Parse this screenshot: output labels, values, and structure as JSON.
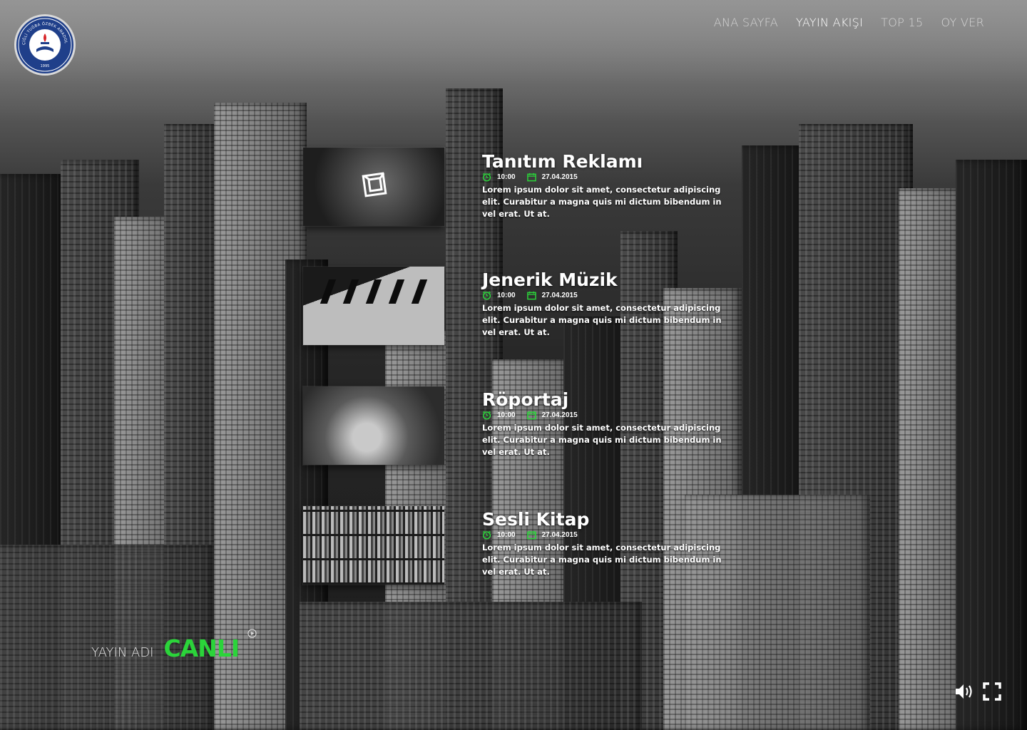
{
  "logo": {
    "text": "ÇİĞLİ TUĞBA ÖZBEK ANADOLU LİSESİ",
    "year": "1995"
  },
  "nav": [
    {
      "label": "ANA SAYFA",
      "active": false
    },
    {
      "label": "YAYIN AKIŞI",
      "active": true
    },
    {
      "label": "TOP 15",
      "active": false
    },
    {
      "label": "OY VER",
      "active": false
    }
  ],
  "schedule": [
    {
      "title": "Tanıtım Reklamı",
      "time": "10:00",
      "date": "27.04.2015",
      "description": "Lorem ipsum dolor sit amet, consectetur adipiscing elit. Curabitur a magna quis mi dictum bibendum in vel erat. Ut at."
    },
    {
      "title": "Jenerik Müzik",
      "time": "10:00",
      "date": "27.04.2015",
      "description": "Lorem ipsum dolor sit amet, consectetur adipiscing elit. Curabitur a magna quis mi dictum bibendum in vel erat. Ut at."
    },
    {
      "title": "Röportaj",
      "time": "10:00",
      "date": "27.04.2015",
      "description": "Lorem ipsum dolor sit amet, consectetur adipiscing elit. Curabitur a magna quis mi dictum bibendum in vel erat. Ut at."
    },
    {
      "title": "Sesli Kitap",
      "time": "10:00",
      "date": "27.04.2015",
      "description": "Lorem ipsum dolor sit amet, consectetur adipiscing elit. Curabitur a magna quis mi dictum bibendum in vel erat. Ut at."
    }
  ],
  "player": {
    "broadcast_name": "YAYIN ADI",
    "status": "CANLI"
  },
  "icons": {
    "clock": "clock-icon",
    "calendar": "calendar-icon",
    "play": "play-icon",
    "speaker": "speaker-icon",
    "fullscreen": "fullscreen-icon"
  },
  "colors": {
    "accent_green": "#2bd43a",
    "logo_blue": "#1f3f8a",
    "nav_active": "#ffffff",
    "nav_inactive": "#d6d6d6"
  }
}
